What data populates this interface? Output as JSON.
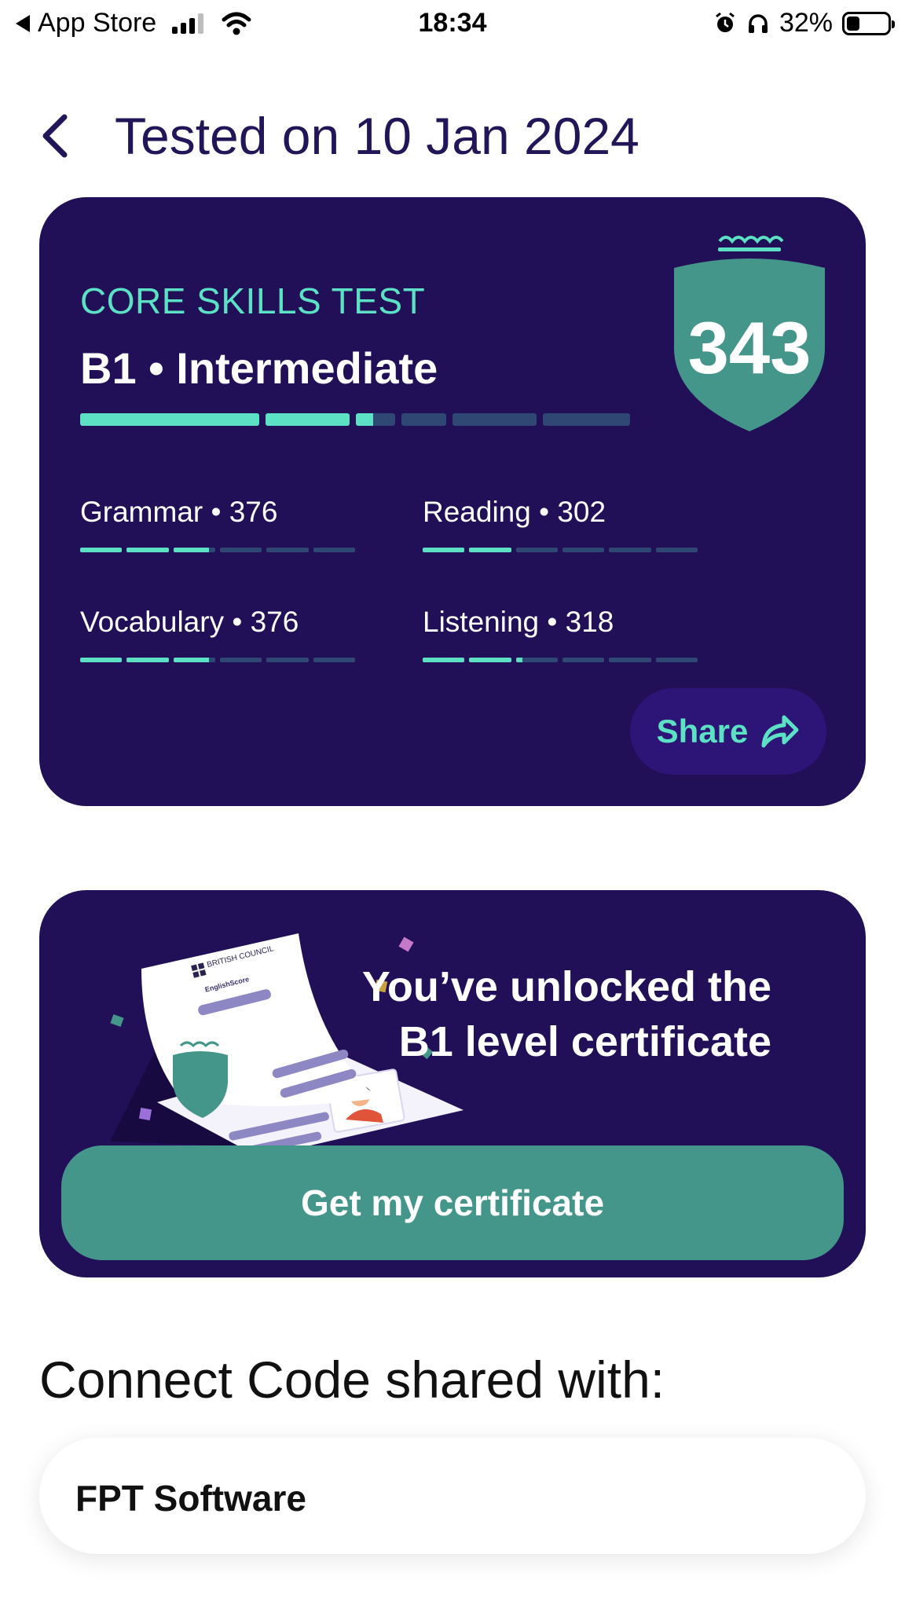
{
  "status_bar": {
    "back_app": "App Store",
    "time": "18:34",
    "battery": "32%",
    "battery_level": 0.32
  },
  "header": {
    "title": "Tested on 10 Jan 2024"
  },
  "score_card": {
    "test_type": "CORE SKILLS TEST",
    "level": "B1 • Intermediate",
    "score": "343",
    "level_progress": [
      1,
      1,
      0.45,
      0,
      0,
      0
    ],
    "skills": [
      {
        "label": "Grammar • 376",
        "progress": [
          1,
          1,
          0.85,
          0,
          0,
          0
        ]
      },
      {
        "label": "Reading • 302",
        "progress": [
          1,
          1,
          0,
          0,
          0,
          0
        ]
      },
      {
        "label": "Vocabulary • 376",
        "progress": [
          1,
          1,
          0.85,
          0,
          0,
          0
        ]
      },
      {
        "label": "Listening • 318",
        "progress": [
          1,
          1,
          0.15,
          0,
          0,
          0
        ]
      }
    ],
    "share_label": "Share"
  },
  "certificate_card": {
    "unlock_text": "You’ve unlocked the B1 level certificate",
    "button_label": "Get my certificate",
    "illustration_brand": "BRITISH COUNCIL",
    "illustration_product": "EnglishScore"
  },
  "connect": {
    "heading": "Connect Code shared with:",
    "organizations": [
      "FPT Software"
    ]
  },
  "colors": {
    "card_bg": "#210f58",
    "accent": "#5ce1c4",
    "button_green": "#44968a",
    "title_color": "#221558"
  }
}
